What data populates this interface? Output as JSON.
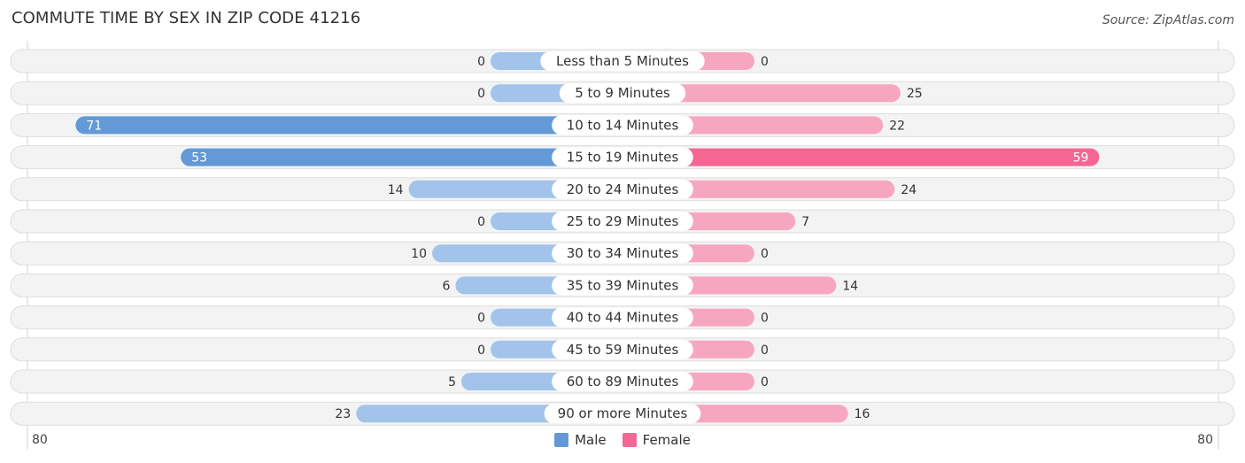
{
  "header": {
    "title": "COMMUTE TIME BY SEX IN ZIP CODE 41216",
    "source": "Source: ZipAtlas.com"
  },
  "colors": {
    "male_strong": "#6399d6",
    "male_light": "#a3c4ea",
    "female_strong": "#f56693",
    "female_light": "#f7a6c0",
    "row_bg": "#f3f3f3",
    "row_border": "#dddddd"
  },
  "legend": [
    {
      "label": "Male",
      "color": "#6399d6"
    },
    {
      "label": "Female",
      "color": "#f56693"
    }
  ],
  "axis": {
    "left_label": "80",
    "right_label": "80"
  },
  "chart_data": {
    "type": "bar",
    "orientation": "horizontal-diverging",
    "title": "COMMUTE TIME BY SEX IN ZIP CODE 41216",
    "xlabel": "",
    "ylabel": "",
    "xlim": [
      -80,
      80
    ],
    "legend_position": "bottom-center",
    "categories": [
      "Less than 5 Minutes",
      "5 to 9 Minutes",
      "10 to 14 Minutes",
      "15 to 19 Minutes",
      "20 to 24 Minutes",
      "25 to 29 Minutes",
      "30 to 34 Minutes",
      "35 to 39 Minutes",
      "40 to 44 Minutes",
      "45 to 59 Minutes",
      "60 to 89 Minutes",
      "90 or more Minutes"
    ],
    "series": [
      {
        "name": "Male",
        "values": [
          0,
          0,
          71,
          53,
          14,
          0,
          10,
          6,
          0,
          0,
          5,
          23
        ]
      },
      {
        "name": "Female",
        "values": [
          0,
          25,
          22,
          59,
          24,
          7,
          0,
          14,
          0,
          0,
          0,
          16
        ]
      }
    ],
    "tick_labels": [
      "80",
      "80"
    ]
  }
}
